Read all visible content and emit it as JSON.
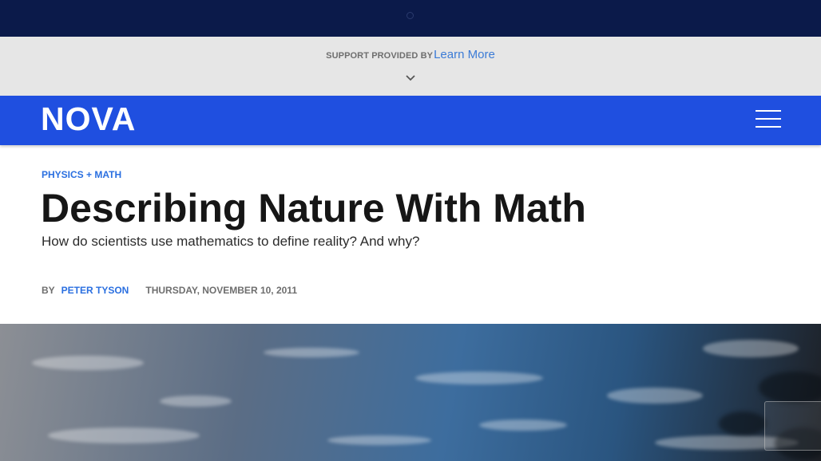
{
  "support": {
    "label": "SUPPORT PROVIDED BY",
    "link": "Learn More"
  },
  "nav": {
    "logo": "NOVA"
  },
  "article": {
    "category": "PHYSICS + MATH",
    "title": "Describing Nature With Math",
    "subtitle": "How do scientists use mathematics to define reality? And why?",
    "by_label": "BY",
    "author": "PETER TYSON",
    "date": "THURSDAY, NOVEMBER 10, 2011"
  },
  "icons": {
    "top": "loading-dot-icon",
    "expand": "chevron-down-icon",
    "menu": "hamburger-menu-icon"
  },
  "colors": {
    "top_bar": "#0b1a4a",
    "nav_bar": "#1f4fe0",
    "accent_link": "#2a6fe0",
    "support_bg": "#e6e6e6",
    "headline": "#161616"
  }
}
